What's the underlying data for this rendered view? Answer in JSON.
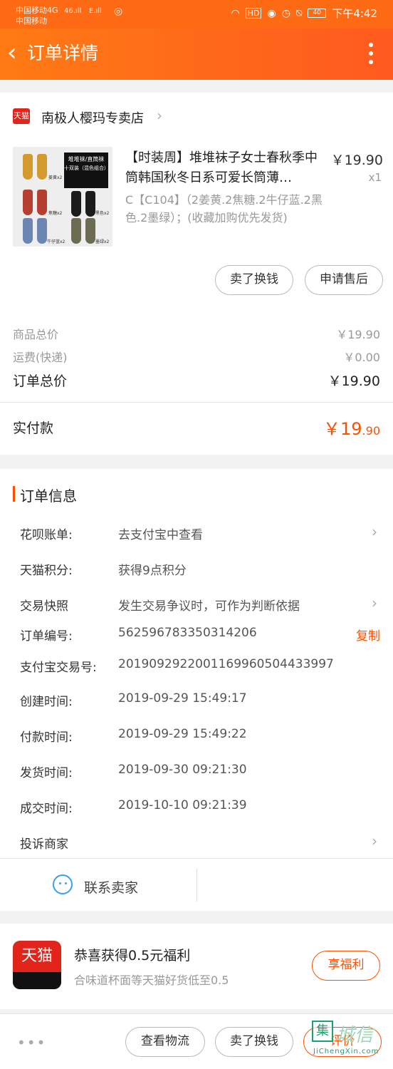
{
  "status_bar": {
    "carrier1": "中国移动4G",
    "carrier2": "中国移动",
    "signal1": "46.ıll",
    "signal2": "E.ıll",
    "battery": "40",
    "time": "下午4:42"
  },
  "nav": {
    "title": "订单详情"
  },
  "store": {
    "badge": "天猫",
    "name": "南极人樱玛专卖店"
  },
  "product": {
    "title": "【时装周】堆堆袜子女士春秋季中筒韩国秋冬日系可爱长筒薄…",
    "price": "￥19.90",
    "qty": "x1",
    "sku": "C【C104】（2姜黄.2焦糖.2牛仔蓝.2黑色.2墨绿）；(收藏加购优先发货)",
    "thumb_banner": "堆堆袜/直筒袜",
    "thumb_sub": "十双装（混色组合）",
    "thumb_labels": [
      "姜黄x2",
      "焦糖x2",
      "黑色x2",
      "牛仔蓝x2",
      "墨绿x2"
    ],
    "btn_resell": "卖了换钱",
    "btn_aftersale": "申请售后"
  },
  "summary": {
    "goods_label": "商品总价",
    "goods_value": "￥19.90",
    "shipping_label": "运费(快递)",
    "shipping_value": "￥0.00",
    "total_label": "订单总价",
    "total_value": "￥19.90",
    "paid_label": "实付款",
    "paid_int": "￥19",
    "paid_dec": ".90"
  },
  "order_info": {
    "title": "订单信息",
    "rows": [
      {
        "label": "花呗账单:",
        "value": "去支付宝中查看"
      },
      {
        "label": "天猫积分:",
        "value": "获得9点积分"
      },
      {
        "label": "交易快照",
        "value": "发生交易争议时，可作为判断依据"
      },
      {
        "label": "订单编号:",
        "value": "562596783350314206"
      },
      {
        "label": "支付宝交易号:",
        "value": "2019092922001169960504433997"
      },
      {
        "label": "创建时间:",
        "value": "2019-09-29 15:49:17"
      },
      {
        "label": "付款时间:",
        "value": "2019-09-29 15:49:22"
      },
      {
        "label": "发货时间:",
        "value": "2019-09-30 09:21:30"
      },
      {
        "label": "成交时间:",
        "value": "2019-10-10 09:21:39"
      },
      {
        "label": "投诉商家",
        "value": ""
      }
    ],
    "copy_label": "复制",
    "contact_label": "联系卖家"
  },
  "promo": {
    "logo_text": "天猫",
    "title": "恭喜获得0.5元福利",
    "subtitle": "合味道杯面等天猫好货低至0.5",
    "button": "享福利"
  },
  "bottom_bar": {
    "more": "•••",
    "logistics": "查看物流",
    "resell": "卖了换钱",
    "review": "评价"
  },
  "watermark": {
    "text": "城信",
    "url": "JiChengXin.com",
    "icon": "集"
  }
}
